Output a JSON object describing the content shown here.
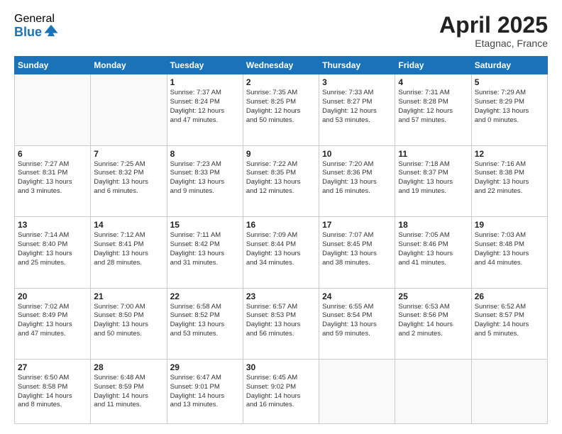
{
  "logo": {
    "general": "General",
    "blue": "Blue"
  },
  "title": "April 2025",
  "location": "Etagnac, France",
  "days_of_week": [
    "Sunday",
    "Monday",
    "Tuesday",
    "Wednesday",
    "Thursday",
    "Friday",
    "Saturday"
  ],
  "weeks": [
    [
      {
        "day": "",
        "info": ""
      },
      {
        "day": "",
        "info": ""
      },
      {
        "day": "1",
        "info": "Sunrise: 7:37 AM\nSunset: 8:24 PM\nDaylight: 12 hours\nand 47 minutes."
      },
      {
        "day": "2",
        "info": "Sunrise: 7:35 AM\nSunset: 8:25 PM\nDaylight: 12 hours\nand 50 minutes."
      },
      {
        "day": "3",
        "info": "Sunrise: 7:33 AM\nSunset: 8:27 PM\nDaylight: 12 hours\nand 53 minutes."
      },
      {
        "day": "4",
        "info": "Sunrise: 7:31 AM\nSunset: 8:28 PM\nDaylight: 12 hours\nand 57 minutes."
      },
      {
        "day": "5",
        "info": "Sunrise: 7:29 AM\nSunset: 8:29 PM\nDaylight: 13 hours\nand 0 minutes."
      }
    ],
    [
      {
        "day": "6",
        "info": "Sunrise: 7:27 AM\nSunset: 8:31 PM\nDaylight: 13 hours\nand 3 minutes."
      },
      {
        "day": "7",
        "info": "Sunrise: 7:25 AM\nSunset: 8:32 PM\nDaylight: 13 hours\nand 6 minutes."
      },
      {
        "day": "8",
        "info": "Sunrise: 7:23 AM\nSunset: 8:33 PM\nDaylight: 13 hours\nand 9 minutes."
      },
      {
        "day": "9",
        "info": "Sunrise: 7:22 AM\nSunset: 8:35 PM\nDaylight: 13 hours\nand 12 minutes."
      },
      {
        "day": "10",
        "info": "Sunrise: 7:20 AM\nSunset: 8:36 PM\nDaylight: 13 hours\nand 16 minutes."
      },
      {
        "day": "11",
        "info": "Sunrise: 7:18 AM\nSunset: 8:37 PM\nDaylight: 13 hours\nand 19 minutes."
      },
      {
        "day": "12",
        "info": "Sunrise: 7:16 AM\nSunset: 8:38 PM\nDaylight: 13 hours\nand 22 minutes."
      }
    ],
    [
      {
        "day": "13",
        "info": "Sunrise: 7:14 AM\nSunset: 8:40 PM\nDaylight: 13 hours\nand 25 minutes."
      },
      {
        "day": "14",
        "info": "Sunrise: 7:12 AM\nSunset: 8:41 PM\nDaylight: 13 hours\nand 28 minutes."
      },
      {
        "day": "15",
        "info": "Sunrise: 7:11 AM\nSunset: 8:42 PM\nDaylight: 13 hours\nand 31 minutes."
      },
      {
        "day": "16",
        "info": "Sunrise: 7:09 AM\nSunset: 8:44 PM\nDaylight: 13 hours\nand 34 minutes."
      },
      {
        "day": "17",
        "info": "Sunrise: 7:07 AM\nSunset: 8:45 PM\nDaylight: 13 hours\nand 38 minutes."
      },
      {
        "day": "18",
        "info": "Sunrise: 7:05 AM\nSunset: 8:46 PM\nDaylight: 13 hours\nand 41 minutes."
      },
      {
        "day": "19",
        "info": "Sunrise: 7:03 AM\nSunset: 8:48 PM\nDaylight: 13 hours\nand 44 minutes."
      }
    ],
    [
      {
        "day": "20",
        "info": "Sunrise: 7:02 AM\nSunset: 8:49 PM\nDaylight: 13 hours\nand 47 minutes."
      },
      {
        "day": "21",
        "info": "Sunrise: 7:00 AM\nSunset: 8:50 PM\nDaylight: 13 hours\nand 50 minutes."
      },
      {
        "day": "22",
        "info": "Sunrise: 6:58 AM\nSunset: 8:52 PM\nDaylight: 13 hours\nand 53 minutes."
      },
      {
        "day": "23",
        "info": "Sunrise: 6:57 AM\nSunset: 8:53 PM\nDaylight: 13 hours\nand 56 minutes."
      },
      {
        "day": "24",
        "info": "Sunrise: 6:55 AM\nSunset: 8:54 PM\nDaylight: 13 hours\nand 59 minutes."
      },
      {
        "day": "25",
        "info": "Sunrise: 6:53 AM\nSunset: 8:56 PM\nDaylight: 14 hours\nand 2 minutes."
      },
      {
        "day": "26",
        "info": "Sunrise: 6:52 AM\nSunset: 8:57 PM\nDaylight: 14 hours\nand 5 minutes."
      }
    ],
    [
      {
        "day": "27",
        "info": "Sunrise: 6:50 AM\nSunset: 8:58 PM\nDaylight: 14 hours\nand 8 minutes."
      },
      {
        "day": "28",
        "info": "Sunrise: 6:48 AM\nSunset: 8:59 PM\nDaylight: 14 hours\nand 11 minutes."
      },
      {
        "day": "29",
        "info": "Sunrise: 6:47 AM\nSunset: 9:01 PM\nDaylight: 14 hours\nand 13 minutes."
      },
      {
        "day": "30",
        "info": "Sunrise: 6:45 AM\nSunset: 9:02 PM\nDaylight: 14 hours\nand 16 minutes."
      },
      {
        "day": "",
        "info": ""
      },
      {
        "day": "",
        "info": ""
      },
      {
        "day": "",
        "info": ""
      }
    ]
  ]
}
